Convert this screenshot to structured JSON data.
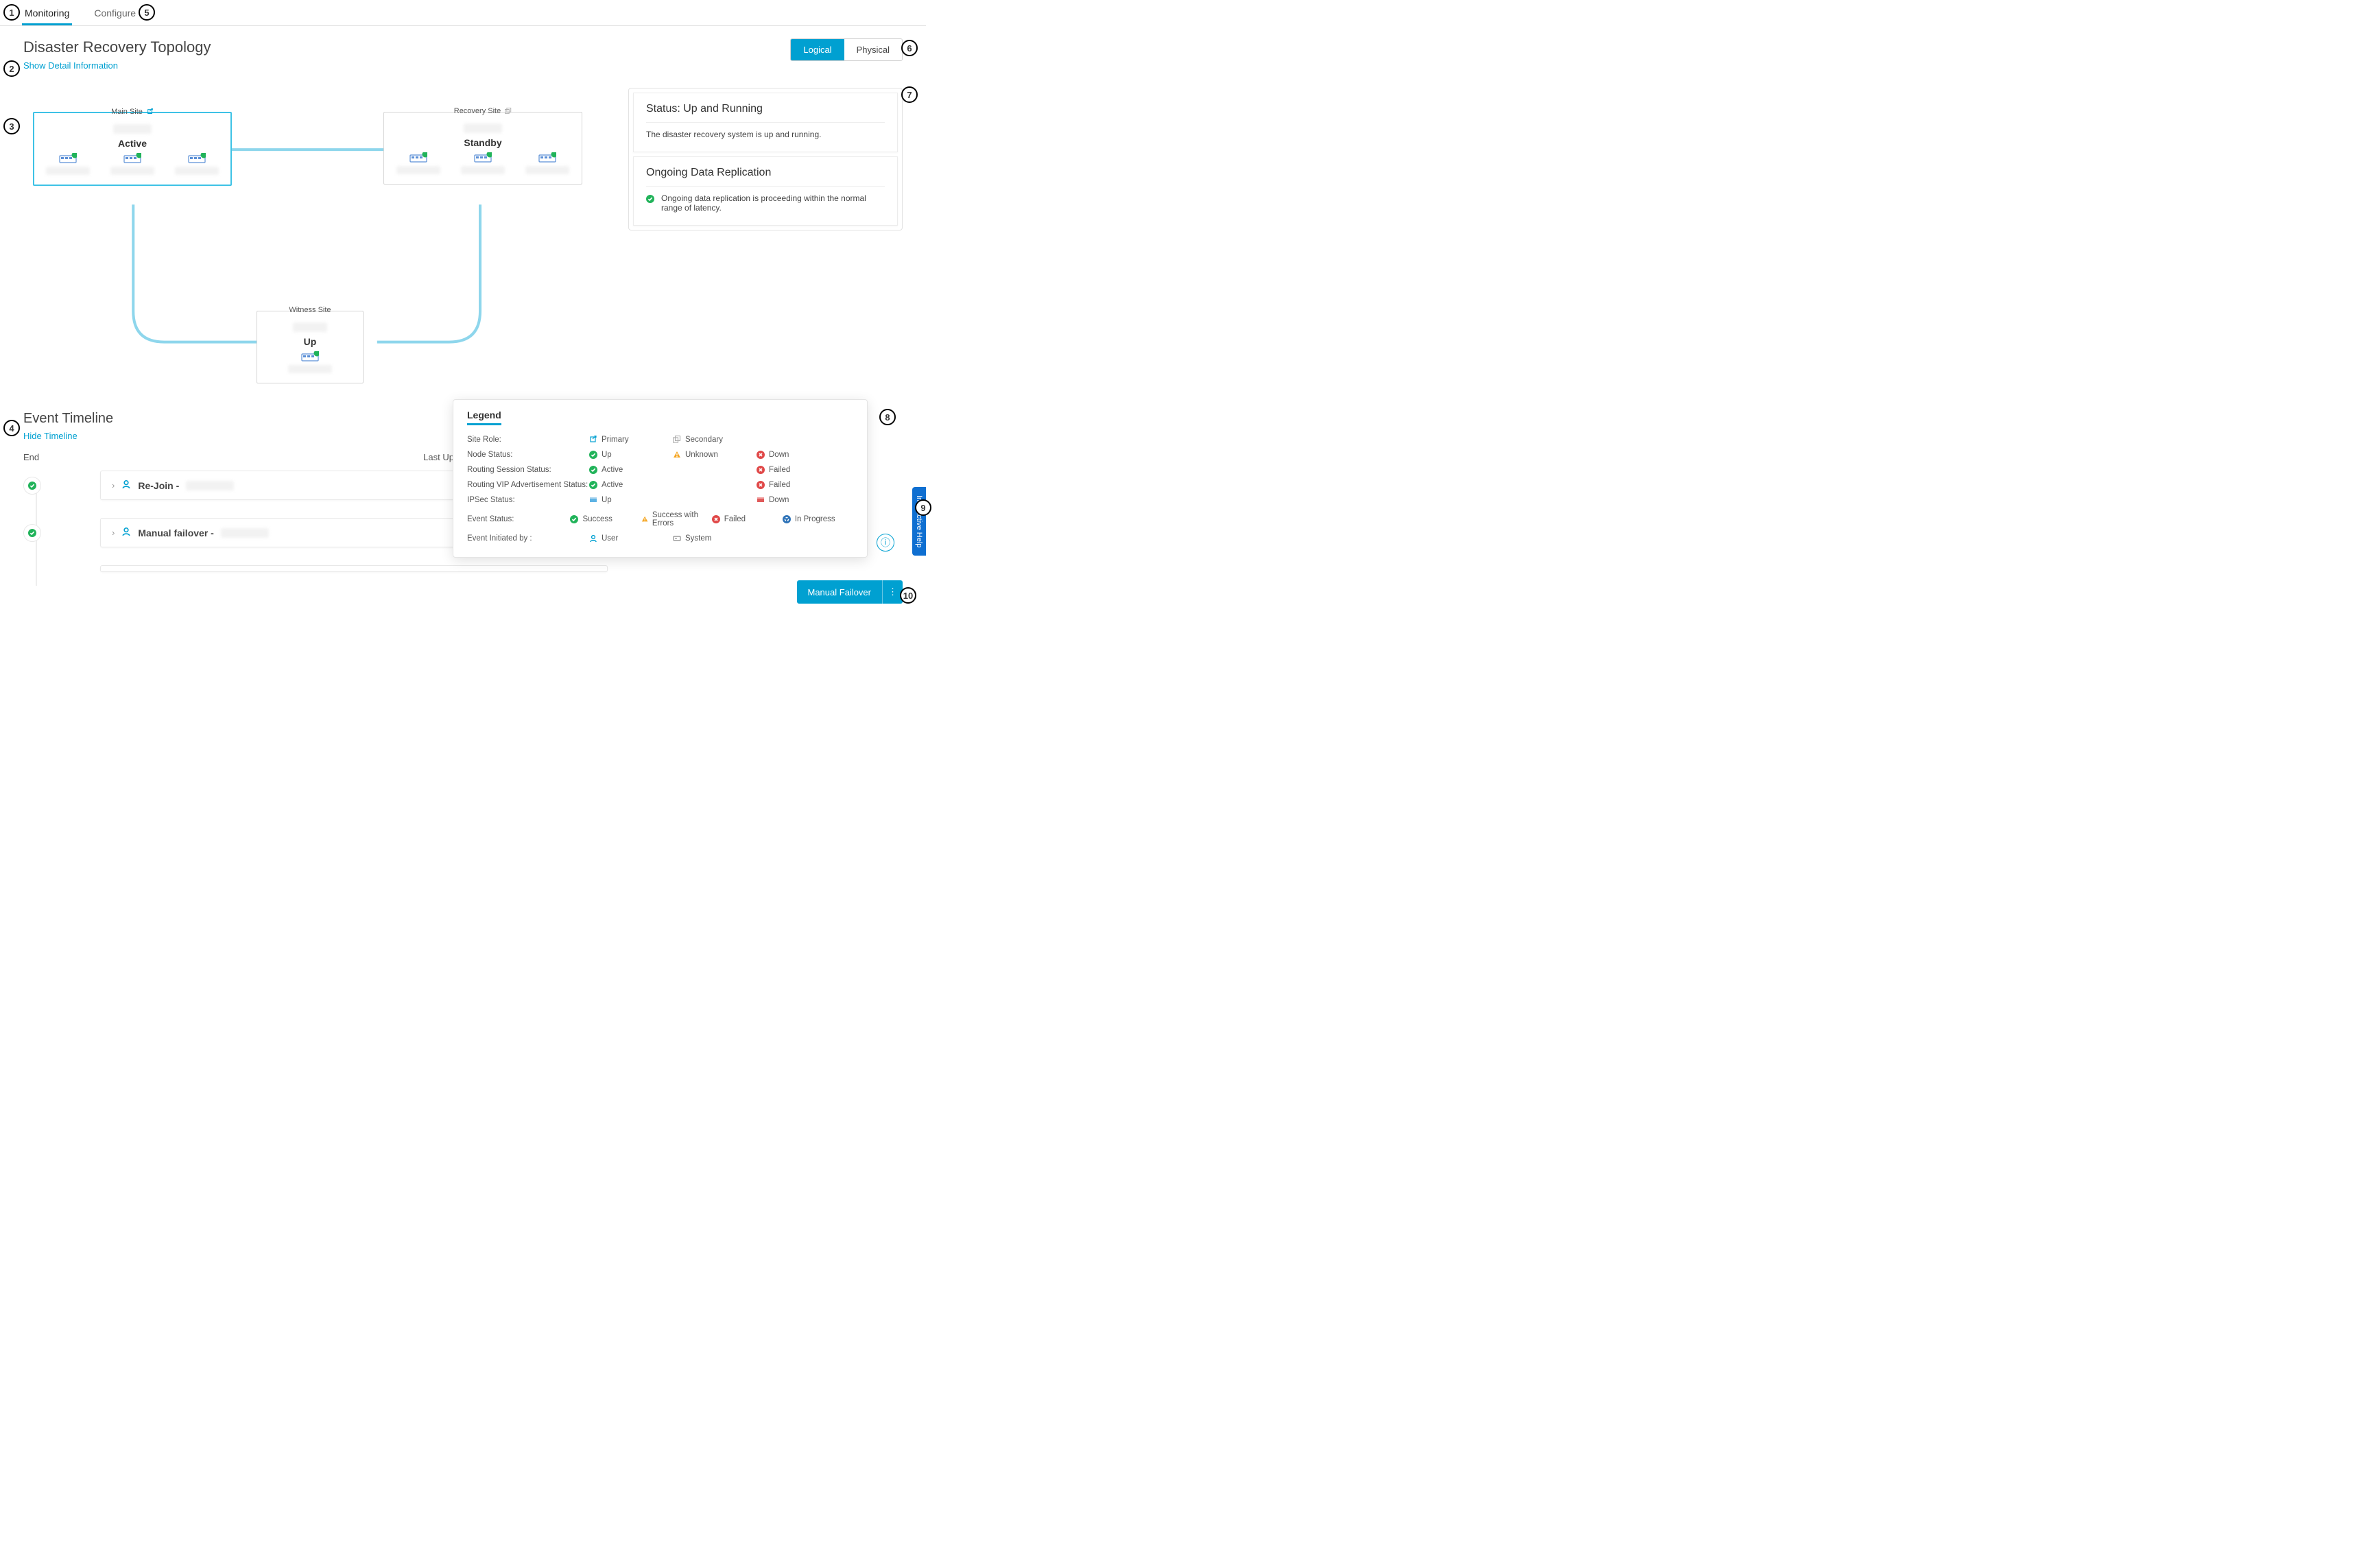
{
  "tabs": {
    "monitoring": "Monitoring",
    "configure": "Configure"
  },
  "page_title": "Disaster Recovery Topology",
  "show_detail": "Show Detail Information",
  "view_toggle": {
    "logical": "Logical",
    "physical": "Physical"
  },
  "sites": {
    "main": {
      "label": "Main Site",
      "state": "Active"
    },
    "recovery": {
      "label": "Recovery Site",
      "state": "Standby"
    },
    "witness": {
      "label": "Witness Site",
      "state": "Up"
    }
  },
  "status_cards": {
    "running": {
      "title": "Status: Up and Running",
      "desc": "The disaster recovery system is up and running."
    },
    "repl": {
      "title": "Ongoing Data Replication",
      "desc": "Ongoing data replication is proceeding within the normal range of latency."
    }
  },
  "timeline": {
    "title": "Event Timeline",
    "hide": "Hide Timeline",
    "end": "End",
    "last": "Last Upda",
    "events": [
      {
        "label": "Re-Join - "
      },
      {
        "label": "Manual failover - "
      }
    ]
  },
  "legend": {
    "title": "Legend",
    "rows": {
      "site_role": {
        "label": "Site Role:",
        "primary": "Primary",
        "secondary": "Secondary"
      },
      "node_status": {
        "label": "Node Status:",
        "up": "Up",
        "unknown": "Unknown",
        "down": "Down"
      },
      "routing_sess": {
        "label": "Routing Session Status:",
        "active": "Active",
        "failed": "Failed"
      },
      "routing_vip": {
        "label": "Routing VIP Advertisement Status:",
        "active": "Active",
        "failed": "Failed"
      },
      "ipsec": {
        "label": "IPSec Status:",
        "up": "Up",
        "down": "Down"
      },
      "event_status": {
        "label": "Event Status:",
        "success": "Success",
        "warn": "Success with Errors",
        "failed": "Failed",
        "progress": "In Progress"
      },
      "initiated": {
        "label": "Event Initiated by :",
        "user": "User",
        "system": "System"
      }
    }
  },
  "action_button": "Manual Failover",
  "interactive_help": "Interactive Help"
}
